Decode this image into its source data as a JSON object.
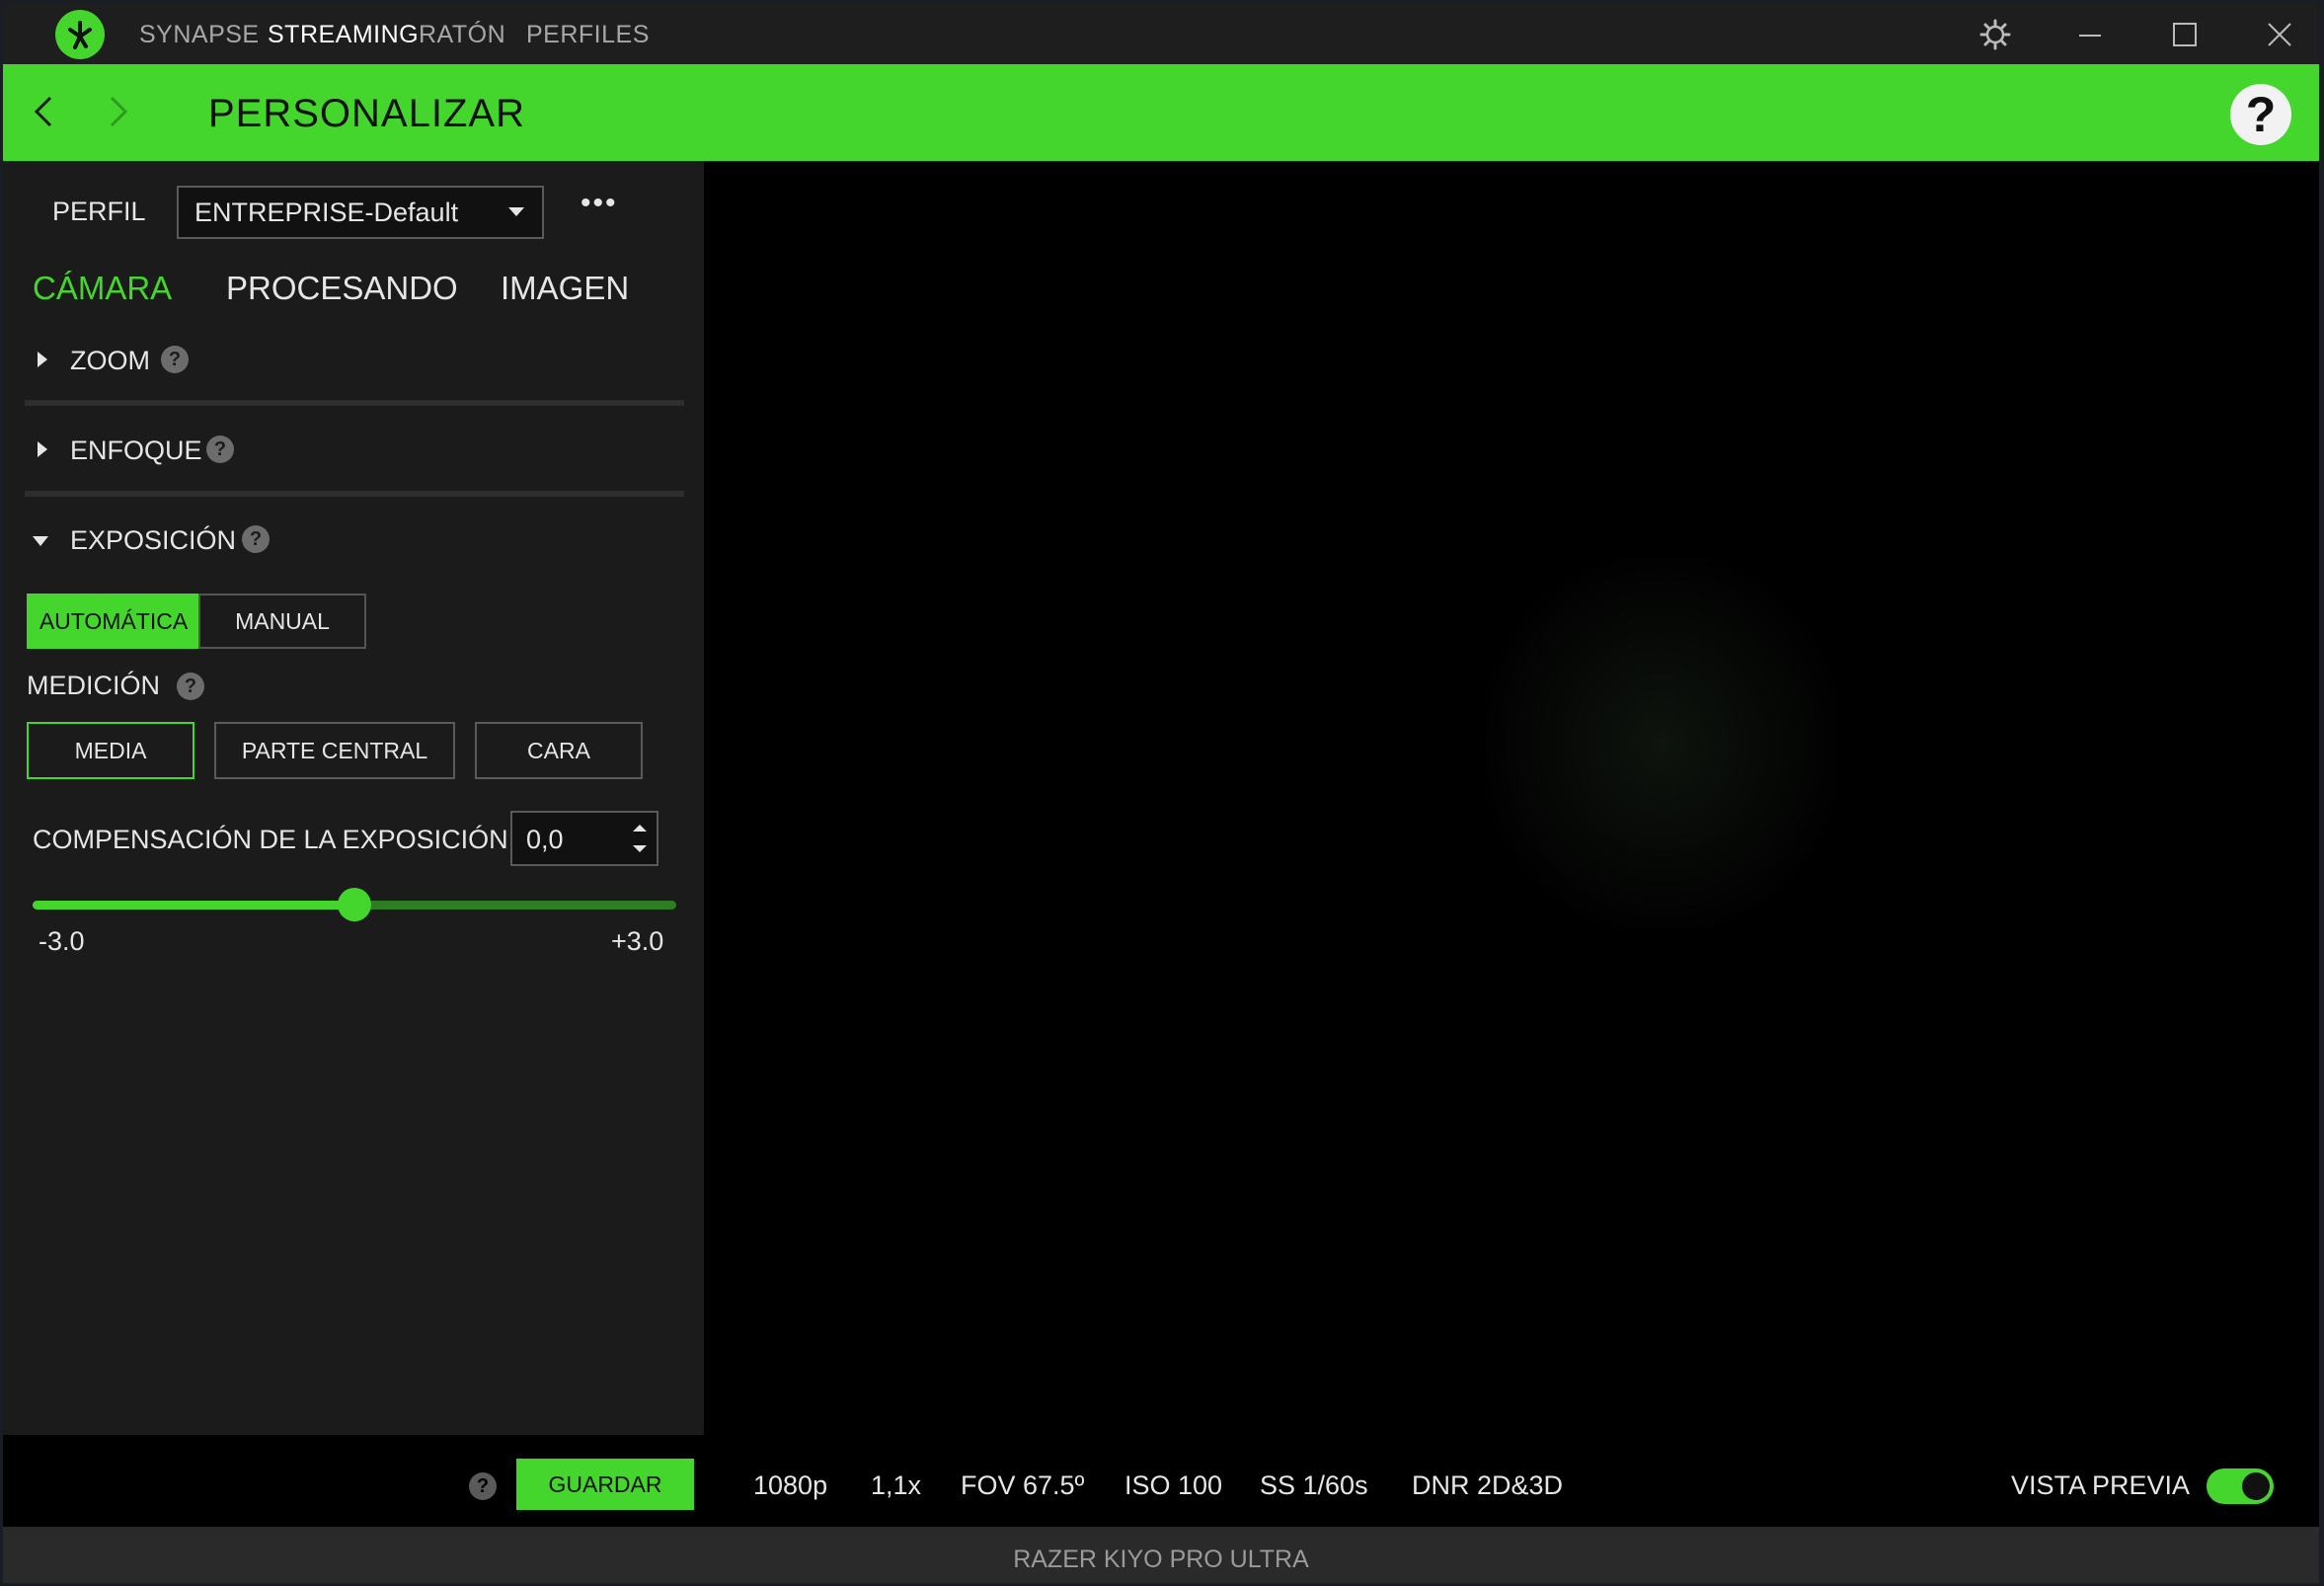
{
  "app": {
    "title_tabs": [
      {
        "label": "SYNAPSE",
        "active": false
      },
      {
        "label": "STREAMING",
        "active": true
      },
      {
        "label": "RATÓN",
        "active": false
      },
      {
        "label": "PERFILES",
        "active": false
      }
    ],
    "brand_color": "#44d62c"
  },
  "header": {
    "title": "PERSONALIZAR",
    "help": "?"
  },
  "profile": {
    "label": "PERFIL",
    "selected": "ENTREPRISE-Default",
    "more": "•••"
  },
  "subtabs": [
    {
      "label": "CÁMARA",
      "active": true
    },
    {
      "label": "PROCESANDO",
      "active": false
    },
    {
      "label": "IMAGEN",
      "active": false
    }
  ],
  "sections": {
    "zoom": {
      "label": "ZOOM",
      "expanded": false
    },
    "focus": {
      "label": "ENFOQUE",
      "expanded": false
    },
    "exposure": {
      "label": "EXPOSICIÓN",
      "expanded": true
    }
  },
  "exposure": {
    "mode_options": [
      "AUTOMÁTICA",
      "MANUAL"
    ],
    "mode_selected": "AUTOMÁTICA",
    "metering_label": "MEDICIÓN",
    "metering_options": [
      "MEDIA",
      "PARTE CENTRAL",
      "CARA"
    ],
    "metering_selected": "MEDIA",
    "compensation_label": "COMPENSACIÓN DE LA EXPOSICIÓN",
    "compensation_value": "0,0",
    "slider": {
      "min": -3.0,
      "max": 3.0,
      "value": 0.0,
      "min_label": "-3.0",
      "max_label": "+3.0"
    }
  },
  "help_mark": "?",
  "bottom": {
    "save_label": "GUARDAR",
    "stats": [
      "1080p",
      "1,1x",
      "FOV 67.5º",
      "ISO 100",
      "SS 1/60s",
      "DNR 2D&3D"
    ],
    "preview_label": "VISTA PREVIA",
    "preview_on": true
  },
  "footer": {
    "device": "RAZER KIYO PRO ULTRA"
  }
}
